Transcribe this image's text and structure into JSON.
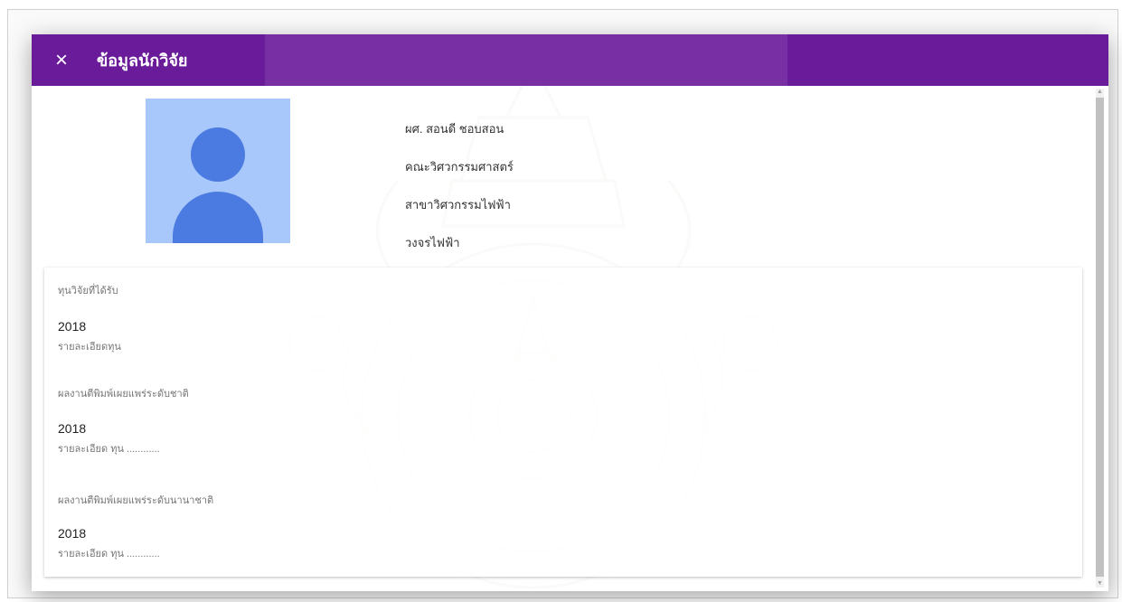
{
  "dialog": {
    "title": "ข้อมูลนักวิจัย",
    "close_icon": "×"
  },
  "profile": {
    "name": "ผศ. สอนดี ชอบสอน",
    "faculty": "คณะวิศวกรรมศาสตร์",
    "department": "สาขาวิศวกรรมไฟฟ้า",
    "field": "วงจรไฟฟ้า"
  },
  "sections": [
    {
      "heading": "ทุนวิจัยที่ได้รับ",
      "year": "2018",
      "detail": "รายละเอียดทุน"
    },
    {
      "heading": "ผลงานตีพิมพ์เผยแพร่ระดับชาติ",
      "year": "2018",
      "detail": "รายละเอียด ทุน ............"
    },
    {
      "heading": "ผลงานตีพิมพ์เผยแพร่ระดับนานาชาติ",
      "year": "2018",
      "detail": "รายละเอียด ทุน ............"
    }
  ],
  "colors": {
    "toolbar": "#6a1b9a",
    "avatar_bg": "#a8c7fa",
    "avatar_fg": "#4b7be0"
  }
}
